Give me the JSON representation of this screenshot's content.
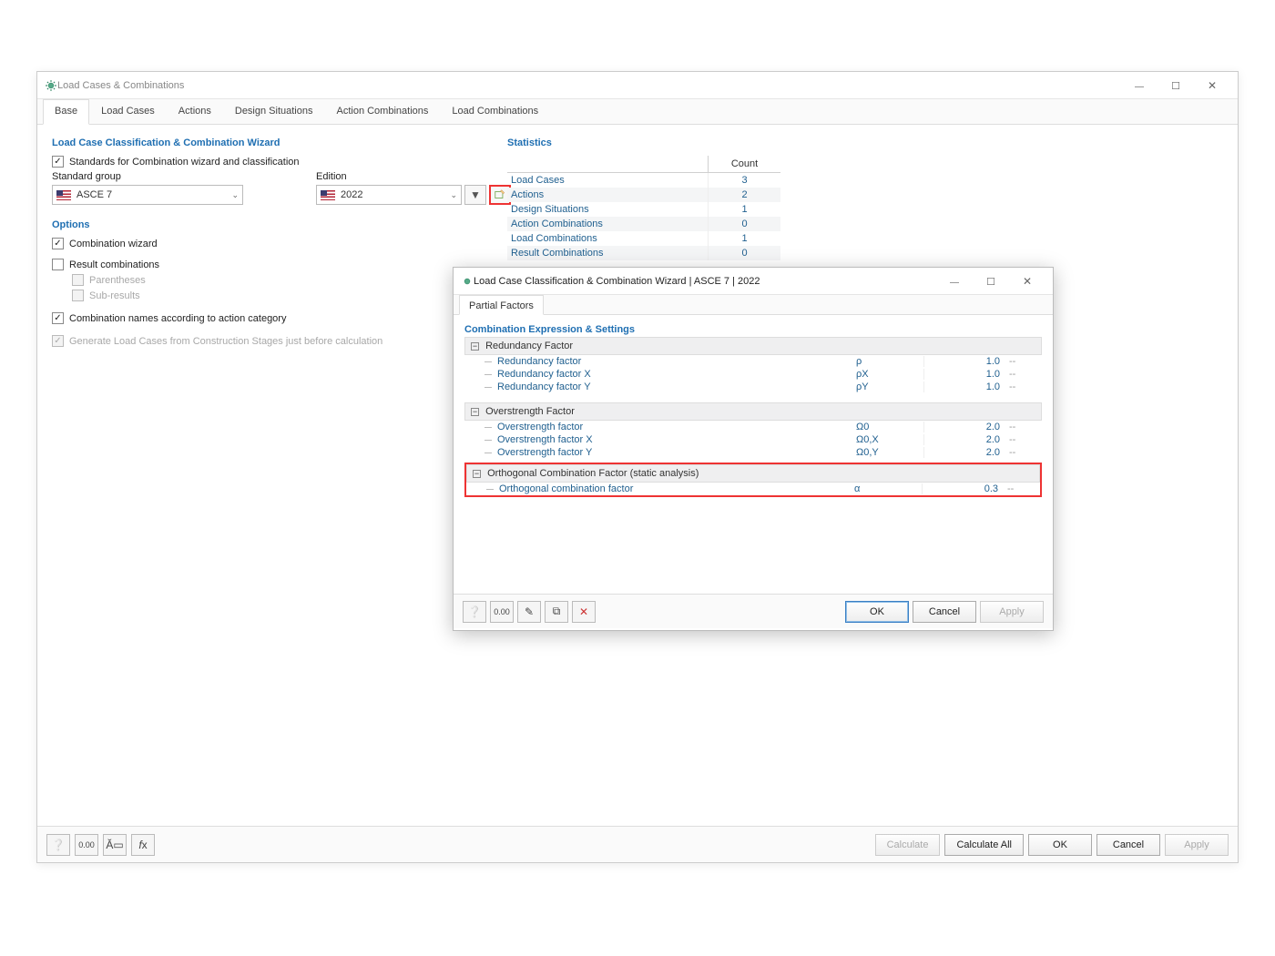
{
  "window": {
    "title": "Load Cases & Combinations"
  },
  "tabs": {
    "items": [
      "Base",
      "Load Cases",
      "Actions",
      "Design Situations",
      "Action Combinations",
      "Load Combinations"
    ],
    "active": 0
  },
  "wizard": {
    "section_title": "Load Case Classification & Combination Wizard",
    "standards_label": "Standards for Combination wizard and classification",
    "standard_group_label": "Standard group",
    "edition_label": "Edition",
    "standard_group_value": "ASCE 7",
    "edition_value": "2022"
  },
  "options": {
    "section_title": "Options",
    "combination_wizard": "Combination wizard",
    "result_combinations": "Result combinations",
    "parentheses": "Parentheses",
    "sub_results": "Sub-results",
    "combo_names": "Combination names according to action category",
    "generate_lc": "Generate Load Cases from Construction Stages just before calculation"
  },
  "statistics": {
    "section_title": "Statistics",
    "header_count": "Count",
    "rows": [
      {
        "label": "Load Cases",
        "value": "3"
      },
      {
        "label": "Actions",
        "value": "2"
      },
      {
        "label": "Design Situations",
        "value": "1"
      },
      {
        "label": "Action Combinations",
        "value": "0"
      },
      {
        "label": "Load Combinations",
        "value": "1"
      },
      {
        "label": "Result Combinations",
        "value": "0"
      }
    ]
  },
  "inner": {
    "title": "Load Case Classification & Combination Wizard | ASCE 7 | 2022",
    "tab": "Partial Factors",
    "section_title": "Combination Expression & Settings",
    "groups": {
      "redundancy": {
        "title": "Redundancy Factor",
        "rows": [
          {
            "label": "Redundancy factor",
            "sym": "ρ",
            "val": "1.0",
            "unit": "--"
          },
          {
            "label": "Redundancy factor X",
            "sym": "ρX",
            "val": "1.0",
            "unit": "--"
          },
          {
            "label": "Redundancy factor Y",
            "sym": "ρY",
            "val": "1.0",
            "unit": "--"
          }
        ]
      },
      "overstrength": {
        "title": "Overstrength Factor",
        "rows": [
          {
            "label": "Overstrength factor",
            "sym": "Ω0",
            "val": "2.0",
            "unit": "--"
          },
          {
            "label": "Overstrength factor X",
            "sym": "Ω0,X",
            "val": "2.0",
            "unit": "--"
          },
          {
            "label": "Overstrength factor Y",
            "sym": "Ω0,Y",
            "val": "2.0",
            "unit": "--"
          }
        ]
      },
      "orthogonal": {
        "title": "Orthogonal Combination Factor (static analysis)",
        "rows": [
          {
            "label": "Orthogonal combination factor",
            "sym": "α",
            "val": "0.3",
            "unit": "--"
          }
        ]
      }
    },
    "buttons": {
      "ok": "OK",
      "cancel": "Cancel",
      "apply": "Apply"
    }
  },
  "footer": {
    "calculate": "Calculate",
    "calculate_all": "Calculate All",
    "ok": "OK",
    "cancel": "Cancel",
    "apply": "Apply"
  }
}
